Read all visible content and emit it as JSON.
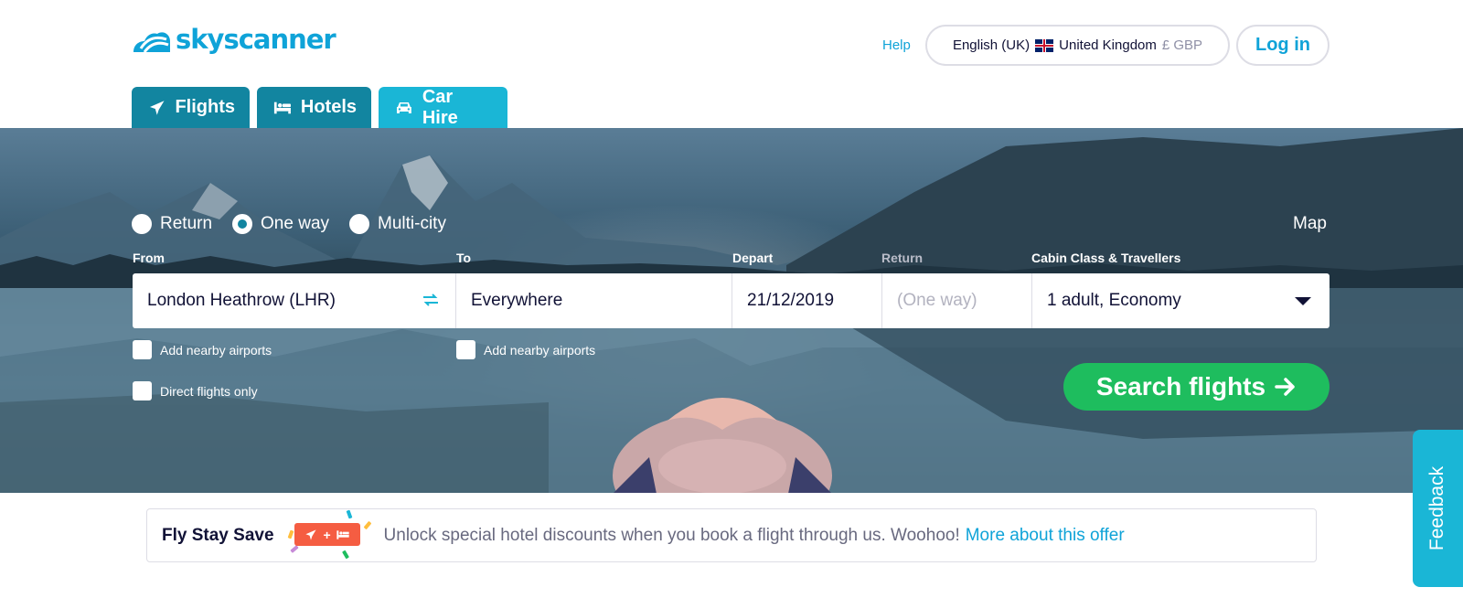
{
  "header": {
    "logo_text": "skyscanner",
    "help": "Help",
    "locale": {
      "language": "English (UK)",
      "country": "United Kingdom",
      "currency": "£ GBP"
    },
    "login": "Log in"
  },
  "tabs": [
    {
      "label": "Flights",
      "icon": "plane-icon"
    },
    {
      "label": "Hotels",
      "icon": "bed-icon"
    },
    {
      "label": "Car Hire",
      "icon": "car-icon"
    }
  ],
  "search": {
    "trip_types": [
      {
        "label": "Return",
        "selected": false
      },
      {
        "label": "One way",
        "selected": true
      },
      {
        "label": "Multi-city",
        "selected": false
      }
    ],
    "map": "Map",
    "labels": {
      "from": "From",
      "to": "To",
      "depart": "Depart",
      "return": "Return",
      "cabin": "Cabin Class & Travellers"
    },
    "values": {
      "from": "London Heathrow (LHR)",
      "to": "Everywhere",
      "depart": "21/12/2019",
      "return": "(One way)",
      "cabin": "1 adult, Economy"
    },
    "checkboxes": {
      "from_nearby": "Add nearby airports",
      "to_nearby": "Add nearby airports",
      "direct": "Direct flights only"
    },
    "button": "Search flights"
  },
  "banner": {
    "title": "Fly Stay Save",
    "text": "Unlock special hotel discounts when you book a flight through us. Woohoo!",
    "link": "More about this offer"
  },
  "feedback": "Feedback",
  "colors": {
    "brand": "#0fa3d8",
    "tab_dark": "#1285a0",
    "tab_light": "#1ab6d6",
    "search_button": "#1ebd5e",
    "badge": "#f55d42"
  }
}
